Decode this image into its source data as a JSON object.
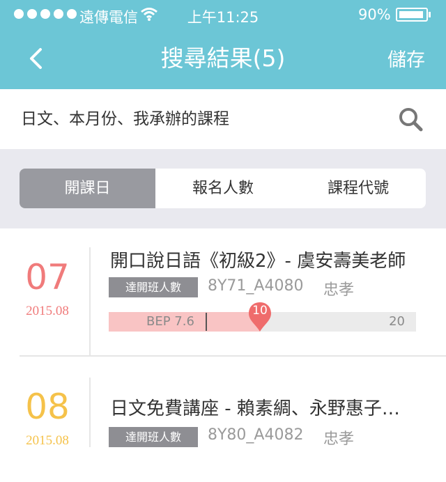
{
  "status_bar": {
    "carrier": "遠傳電信",
    "time": "上午11:25",
    "battery": "90%"
  },
  "nav": {
    "title": "搜尋結果(5)",
    "save": "儲存"
  },
  "search": {
    "text": "日文、本月份、我承辦的課程"
  },
  "sort_tabs": [
    {
      "label": "開課日",
      "active": true
    },
    {
      "label": "報名人數",
      "active": false
    },
    {
      "label": "課程代號",
      "active": false
    }
  ],
  "results": [
    {
      "day": "07",
      "year_month": "2015.08",
      "date_color": "#f07b7b",
      "title": "開口說日語《初級2》- 虞安壽美老師",
      "badge": "達開班人數",
      "code": "8Y71_A4080",
      "person": "忠孝",
      "progress": {
        "bep_label": "BEP 7.6",
        "bep": 7.6,
        "current": "10",
        "current_value": 10,
        "max": "20",
        "max_value": 20
      }
    },
    {
      "day": "08",
      "year_month": "2015.08",
      "date_color": "#f5c24a",
      "title": "日文免費講座 - 賴素綢、永野惠子…",
      "badge": "達開班人數",
      "code": "8Y80_A4082",
      "person": "忠孝"
    }
  ],
  "colors": {
    "header": "#6cc6d6",
    "active_tab": "#999aa0",
    "bar_fill": "#f9c4c4",
    "pin": "#ef6c6c"
  }
}
